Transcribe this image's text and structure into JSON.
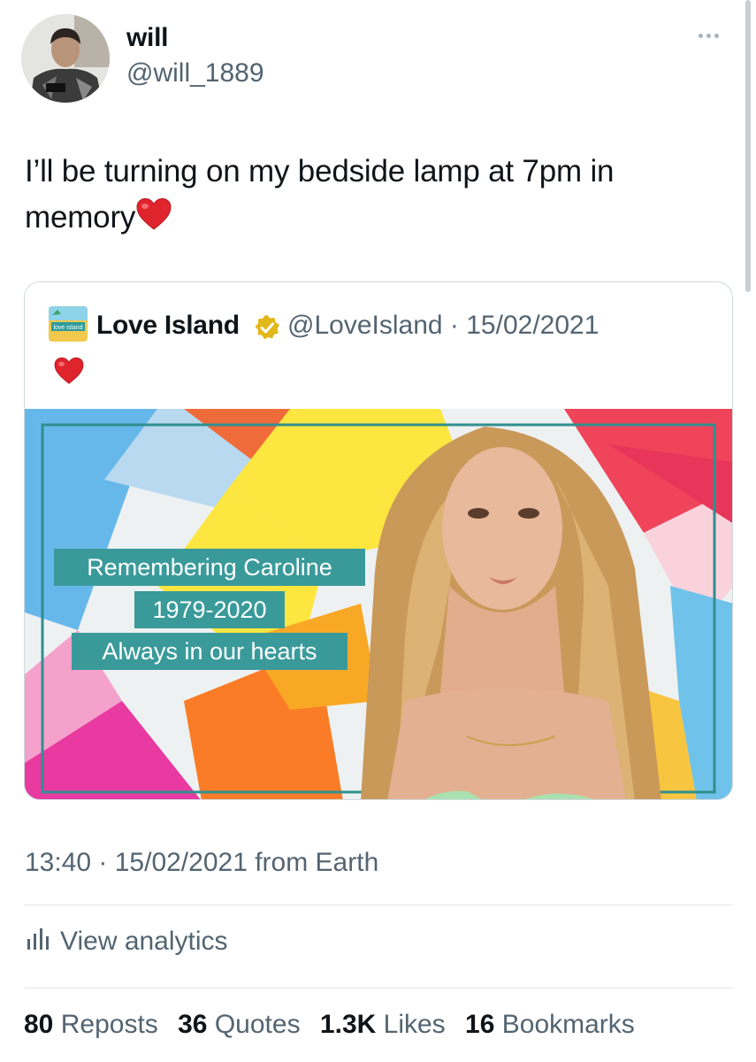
{
  "author": {
    "display_name": "will",
    "handle": "@will_1889"
  },
  "tweet": {
    "text": "I’ll be turning on my bedside lamp at 7pm in memory",
    "emoji": "red-heart"
  },
  "quoted_tweet": {
    "name": "Love Island",
    "handle": "@LoveIsland",
    "separator": "·",
    "date": "15/02/2021",
    "emoji": "red-heart",
    "image": {
      "line1": "Remembering Caroline",
      "line2": "1979-2020",
      "line3": "Always in our hearts"
    },
    "avatar_text": "love island"
  },
  "timestamp": "13:40 · 15/02/2021 from Earth",
  "analytics_label": "View analytics",
  "stats": {
    "reposts_count": "80",
    "reposts_label": "Reposts",
    "quotes_count": "36",
    "quotes_label": "Quotes",
    "likes_count": "1.3K",
    "likes_label": "Likes",
    "bookmarks_count": "16",
    "bookmarks_label": "Bookmarks"
  },
  "colors": {
    "text": "#0f1419",
    "secondary": "#536471",
    "heart": "#e0242e",
    "verified_gold": "#e2b719",
    "banner_teal": "#3a9a9a"
  }
}
